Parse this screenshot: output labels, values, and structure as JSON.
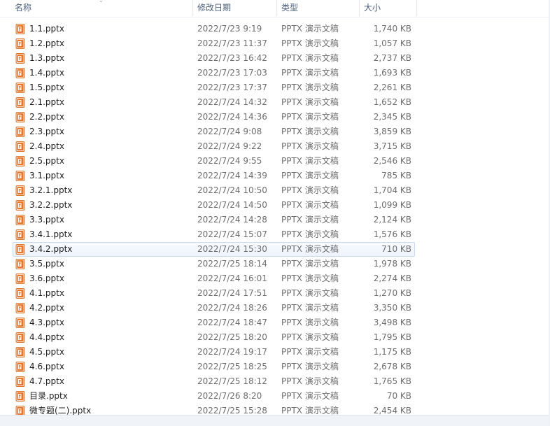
{
  "columns": {
    "name": "名称",
    "date": "修改日期",
    "type": "类型",
    "size": "大小"
  },
  "icon": "powerpoint-file-icon",
  "accent_colors": {
    "icon_orange": "#e8772e",
    "selection_border": "#c8d9ee"
  },
  "files": [
    {
      "name": "1.1.pptx",
      "date": "2022/7/23 9:19",
      "type": "PPTX 演示文稿",
      "size": "1,740 KB"
    },
    {
      "name": "1.2.pptx",
      "date": "2022/7/23 11:37",
      "type": "PPTX 演示文稿",
      "size": "1,057 KB"
    },
    {
      "name": "1.3.pptx",
      "date": "2022/7/23 16:42",
      "type": "PPTX 演示文稿",
      "size": "2,737 KB"
    },
    {
      "name": "1.4.pptx",
      "date": "2022/7/23 17:03",
      "type": "PPTX 演示文稿",
      "size": "1,693 KB"
    },
    {
      "name": "1.5.pptx",
      "date": "2022/7/23 17:37",
      "type": "PPTX 演示文稿",
      "size": "2,261 KB"
    },
    {
      "name": "2.1.pptx",
      "date": "2022/7/24 14:32",
      "type": "PPTX 演示文稿",
      "size": "1,652 KB"
    },
    {
      "name": "2.2.pptx",
      "date": "2022/7/24 14:36",
      "type": "PPTX 演示文稿",
      "size": "2,345 KB"
    },
    {
      "name": "2.3.pptx",
      "date": "2022/7/24 9:08",
      "type": "PPTX 演示文稿",
      "size": "3,859 KB"
    },
    {
      "name": "2.4.pptx",
      "date": "2022/7/24 9:22",
      "type": "PPTX 演示文稿",
      "size": "3,715 KB"
    },
    {
      "name": "2.5.pptx",
      "date": "2022/7/24 9:55",
      "type": "PPTX 演示文稿",
      "size": "2,546 KB"
    },
    {
      "name": "3.1.pptx",
      "date": "2022/7/24 14:39",
      "type": "PPTX 演示文稿",
      "size": "785 KB"
    },
    {
      "name": "3.2.1.pptx",
      "date": "2022/7/24 10:50",
      "type": "PPTX 演示文稿",
      "size": "1,704 KB"
    },
    {
      "name": "3.2.2.pptx",
      "date": "2022/7/24 14:50",
      "type": "PPTX 演示文稿",
      "size": "1,099 KB"
    },
    {
      "name": "3.3.pptx",
      "date": "2022/7/24 14:28",
      "type": "PPTX 演示文稿",
      "size": "2,124 KB"
    },
    {
      "name": "3.4.1.pptx",
      "date": "2022/7/24 15:07",
      "type": "PPTX 演示文稿",
      "size": "1,576 KB"
    },
    {
      "name": "3.4.2.pptx",
      "date": "2022/7/24 15:30",
      "type": "PPTX 演示文稿",
      "size": "710 KB",
      "selected": true
    },
    {
      "name": "3.5.pptx",
      "date": "2022/7/25 18:14",
      "type": "PPTX 演示文稿",
      "size": "1,978 KB"
    },
    {
      "name": "3.6.pptx",
      "date": "2022/7/24 16:01",
      "type": "PPTX 演示文稿",
      "size": "2,274 KB"
    },
    {
      "name": "4.1.pptx",
      "date": "2022/7/24 17:51",
      "type": "PPTX 演示文稿",
      "size": "1,270 KB"
    },
    {
      "name": "4.2.pptx",
      "date": "2022/7/24 18:26",
      "type": "PPTX 演示文稿",
      "size": "3,350 KB"
    },
    {
      "name": "4.3.pptx",
      "date": "2022/7/24 18:47",
      "type": "PPTX 演示文稿",
      "size": "3,498 KB"
    },
    {
      "name": "4.4.pptx",
      "date": "2022/7/25 18:20",
      "type": "PPTX 演示文稿",
      "size": "1,795 KB"
    },
    {
      "name": "4.5.pptx",
      "date": "2022/7/24 19:17",
      "type": "PPTX 演示文稿",
      "size": "1,175 KB"
    },
    {
      "name": "4.6.pptx",
      "date": "2022/7/25 18:25",
      "type": "PPTX 演示文稿",
      "size": "2,678 KB"
    },
    {
      "name": "4.7.pptx",
      "date": "2022/7/25 18:12",
      "type": "PPTX 演示文稿",
      "size": "1,765 KB"
    },
    {
      "name": "目录.pptx",
      "date": "2022/7/26 8:20",
      "type": "PPTX 演示文稿",
      "size": "70 KB"
    },
    {
      "name": "微专题(二).pptx",
      "date": "2022/7/25 15:28",
      "type": "PPTX 演示文稿",
      "size": "2,454 KB"
    }
  ]
}
